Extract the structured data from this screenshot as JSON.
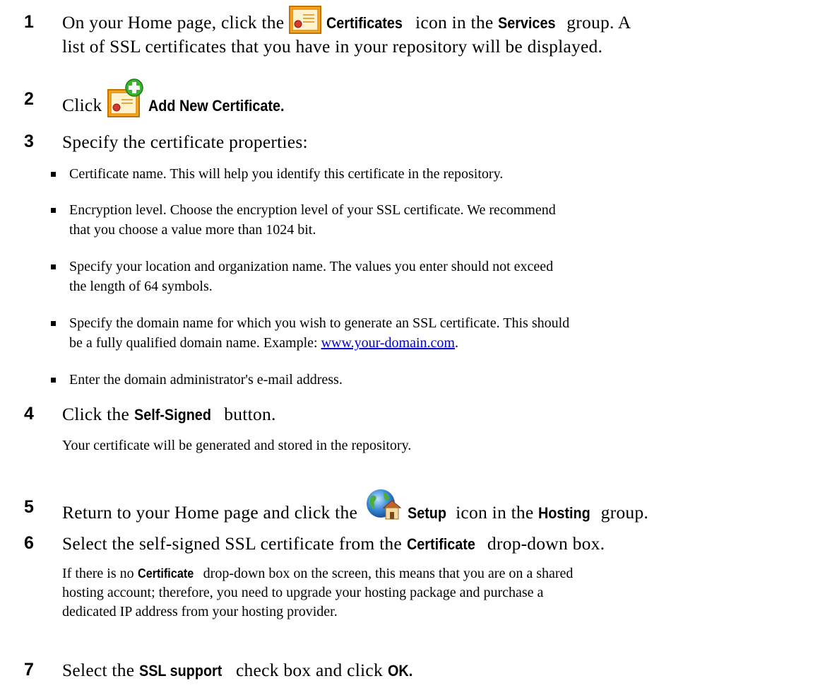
{
  "steps": [
    {
      "num": "1",
      "a": "On your Home page, click the",
      "b": "Certificates",
      "c": "icon in the",
      "d": "Services",
      "e": "group. A",
      "line2": "list of SSL certificates that you have in your repository will be displayed."
    },
    {
      "num": "2",
      "a": "Click",
      "b": "Add New Certificate."
    },
    {
      "num": "3",
      "a": "Specify the certificate properties:"
    },
    {
      "num": "4",
      "a": "Click the",
      "b": "Self-Signed",
      "c": "button."
    },
    {
      "num": "5",
      "a": "Return to your Home page and click the",
      "b": "Setup",
      "c": "icon in the",
      "d": "Hosting",
      "e": "group."
    },
    {
      "num": "6",
      "a": "Select the self-signed SSL certificate from the",
      "b": "Certificate",
      "c": "drop-down box."
    },
    {
      "num": "7",
      "a": "Select the",
      "b": "SSL support",
      "c": "check box and click",
      "d": "OK."
    }
  ],
  "bullets": [
    {
      "text": "Certificate name. This will help you identify this certificate in the repository."
    },
    {
      "text": "Encryption level. Choose the encryption level of your SSL certificate. We recommend",
      "line2": "that you choose a value more than 1024 bit."
    },
    {
      "text": "Specify your location and organization name. The values you enter should not exceed",
      "line2": "the length of 64 symbols."
    },
    {
      "text": "Specify the domain name for which you wish to generate an SSL certificate. This should",
      "line2_a": "be a fully qualified domain name. Example:",
      "link": "www.your-domain.com",
      "line2_b": "."
    },
    {
      "text": "Enter the domain administrator's e-mail address."
    }
  ],
  "para4": "Your certificate will be generated and stored in the repository.",
  "para6": {
    "a": "If there is no",
    "b": "Certificate",
    "c": "drop-down box on the screen, this means that you are on a shared",
    "line2": "hosting account; therefore, you need to upgrade your hosting package and purchase a",
    "line3": "dedicated IP address from your hosting provider."
  },
  "icons": {
    "certificates": "certificate-icon",
    "add_certificate": "add-certificate-icon",
    "setup": "hosting-setup-icon"
  },
  "colors": {
    "link": "#0000cc",
    "cert_orange": "#f2a21c",
    "add_green": "#3bb232"
  }
}
